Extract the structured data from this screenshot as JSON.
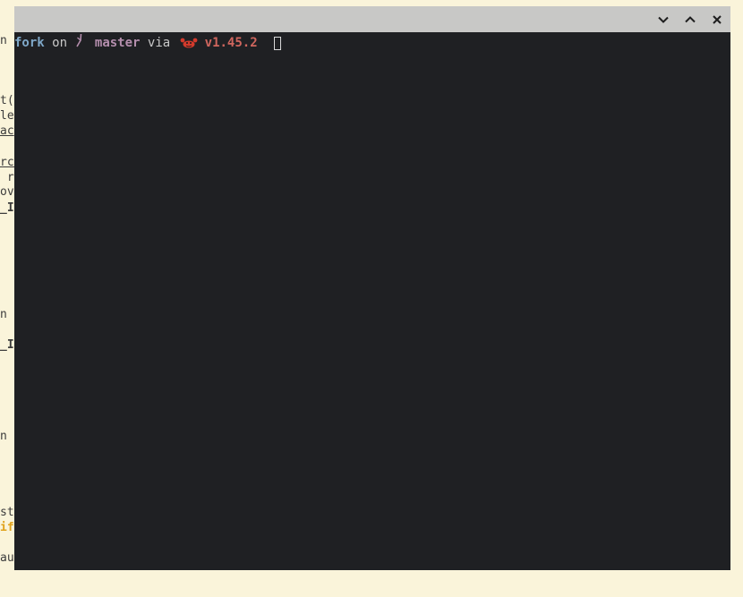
{
  "background_editor": {
    "lines": [
      {
        "text": "n",
        "style": ""
      },
      {
        "text": "t(s",
        "style": ""
      },
      {
        "text": "le",
        "style": ""
      },
      {
        "text": "ac",
        "style": "underline"
      },
      {
        "text": "rc/",
        "style": "underline"
      },
      {
        "text": " ru",
        "style": ""
      },
      {
        "text": "ov/",
        "style": ""
      },
      {
        "text": "_IN",
        "style": "bold"
      },
      {
        "text": "n M",
        "style": ""
      },
      {
        "text": "_IN",
        "style": "bold"
      },
      {
        "text": "n M",
        "style": ""
      },
      {
        "text": "sta",
        "style": ""
      },
      {
        "text": "if",
        "style": "kw"
      },
      {
        "text": "aul",
        "style": ""
      }
    ]
  },
  "terminal": {
    "titlebar": {
      "minimize_icon": "chevron-down-icon",
      "maximize_icon": "chevron-up-icon",
      "close_icon": "close-icon"
    },
    "prompt": {
      "directory": "fork",
      "on_word": "on",
      "branch_icon": "git-branch-icon",
      "branch": "master",
      "via_word": "via",
      "language_icon": "rust-crab-icon",
      "version": "v1.45.2"
    }
  },
  "colors": {
    "desktop_bg": "#faf4da",
    "terminal_bg": "#1f2023",
    "titlebar_bg": "#c8c8c6",
    "directory": "#7fa8c9",
    "branch": "#b48ead",
    "version": "#d0665e"
  }
}
